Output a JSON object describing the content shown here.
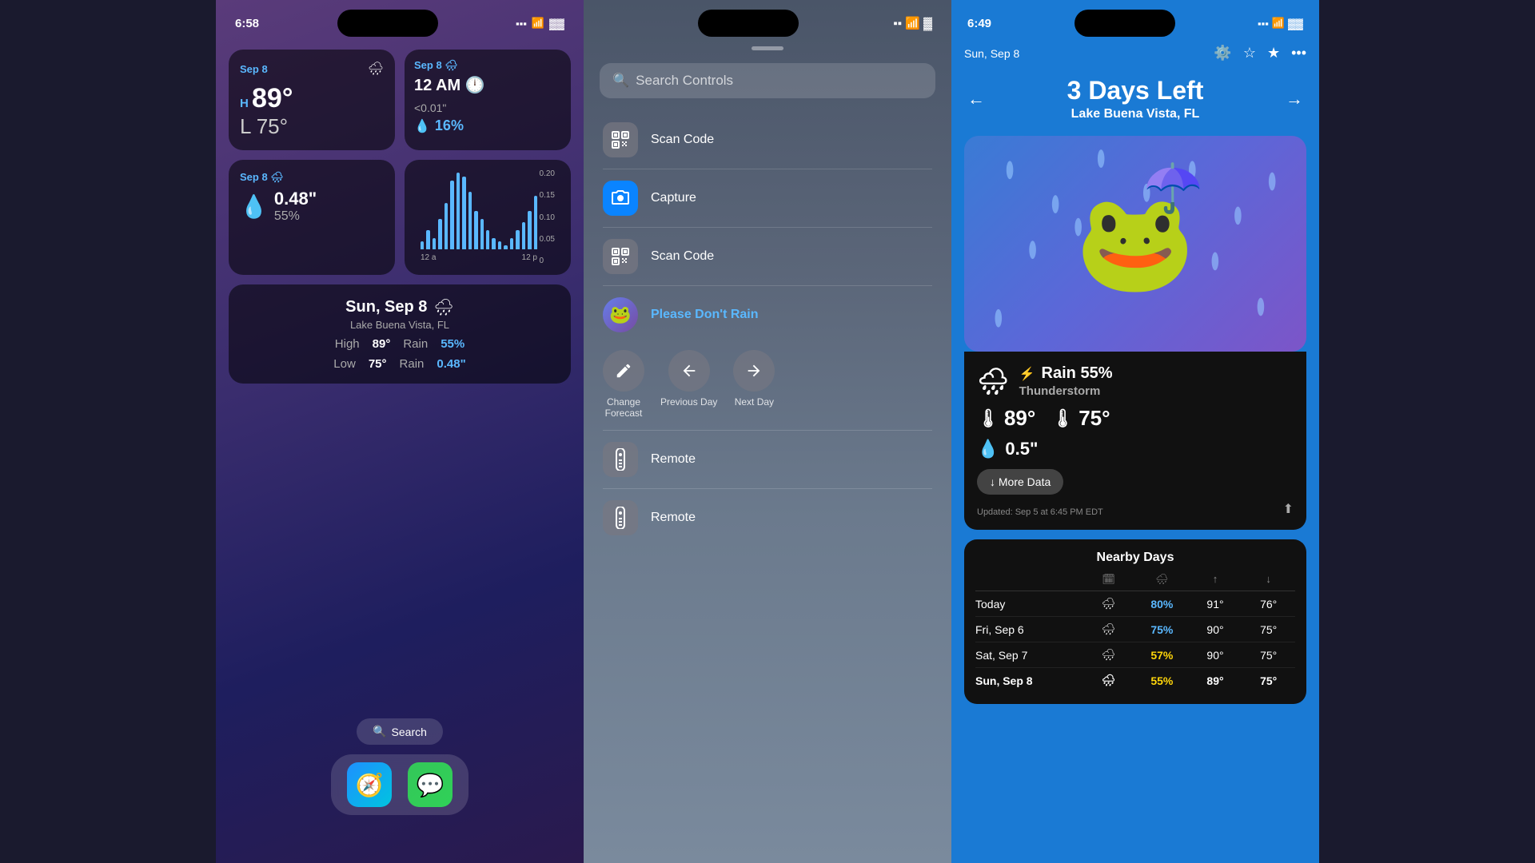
{
  "screen1": {
    "status_time": "6:58",
    "wifi_icon": "📶",
    "battery_icon": "🔋",
    "widget1": {
      "date": "Sep 8",
      "icon": "🌧",
      "high_label": "H",
      "high_temp": "89°",
      "low_label": "L",
      "low_temp": "75°"
    },
    "widget2": {
      "date": "Sep 8",
      "time": "12 AM",
      "icon": "🌧",
      "icon2": "🕛",
      "precip": "<0.01\"",
      "percent": "16%"
    },
    "widget3": {
      "date": "Sep 8",
      "icon": "🌧",
      "amount": "0.48\"",
      "percent": "55%"
    },
    "widget5": {
      "date": "Sun, Sep 8",
      "icon": "🌧",
      "location": "Lake Buena Vista, FL",
      "high_label": "High",
      "high_temp": "89°",
      "rain_label": "Rain",
      "rain_pct": "55%",
      "low_label": "Low",
      "low_temp": "75°",
      "rain_amount_label": "Rain",
      "rain_amount": "0.48\""
    },
    "search_label": "Search",
    "dock": {
      "safari_icon": "🧭",
      "messages_icon": "💬"
    }
  },
  "screen2": {
    "status_time": "",
    "search_placeholder": "Search Controls",
    "items": [
      {
        "id": "scan-code-1",
        "label": "Scan Code",
        "icon": "qr",
        "type": "gray"
      },
      {
        "id": "capture",
        "label": "Capture",
        "icon": "camera",
        "type": "blue"
      },
      {
        "id": "scan-code-2",
        "label": "Scan Code",
        "icon": "qr",
        "type": "gray"
      },
      {
        "id": "please-dont-rain",
        "label": "Please Don't Rain",
        "icon": "🐸",
        "type": "app"
      }
    ],
    "forecast_controls": {
      "change_forecast": "Change\nForecast",
      "previous_day": "Previous Day",
      "next_day": "Next Day"
    },
    "remote_label": "Remote",
    "remote_label2": "Remote"
  },
  "screen3": {
    "status_time": "6:49",
    "date_label": "Sun, Sep 8",
    "days_left": "3  Days Left",
    "location": "Lake Buena Vista, FL",
    "weather": {
      "rain_pct": "Rain 55%",
      "thunder": "Thunderstorm",
      "high_temp": "89°",
      "low_temp": "75°",
      "rain_amount": "0.5\""
    },
    "more_data_label": "↓  More Data",
    "updated_label": "Updated: Sep 5 at 6:45 PM EDT",
    "nearby_days": {
      "title": "Nearby Days",
      "headers": [
        "",
        "🗓",
        "🌧",
        "↑",
        "↓"
      ],
      "rows": [
        {
          "label": "Today",
          "icon": "🌧",
          "pct": "80%",
          "pct_color": "blue",
          "high": "91°",
          "low": "76°"
        },
        {
          "label": "Fri, Sep 6",
          "icon": "🌧",
          "pct": "75%",
          "pct_color": "blue",
          "high": "90°",
          "low": "75°"
        },
        {
          "label": "Sat, Sep 7",
          "icon": "🌧",
          "pct": "57%",
          "pct_color": "yellow",
          "high": "90°",
          "low": "75°"
        },
        {
          "label": "Sun, Sep 8",
          "icon": "🌧",
          "pct": "55%",
          "pct_color": "yellow",
          "high": "89°",
          "low": "75°",
          "bold": true
        }
      ]
    }
  },
  "chart": {
    "bars": [
      2,
      5,
      3,
      8,
      12,
      18,
      20,
      19,
      15,
      10,
      8,
      5,
      3,
      2,
      1,
      3,
      5,
      7,
      10,
      14
    ],
    "x_labels": [
      "12 a",
      "12 p"
    ],
    "y_labels": [
      "0.20",
      "0.15",
      "0.10",
      "0.05",
      "0"
    ]
  }
}
